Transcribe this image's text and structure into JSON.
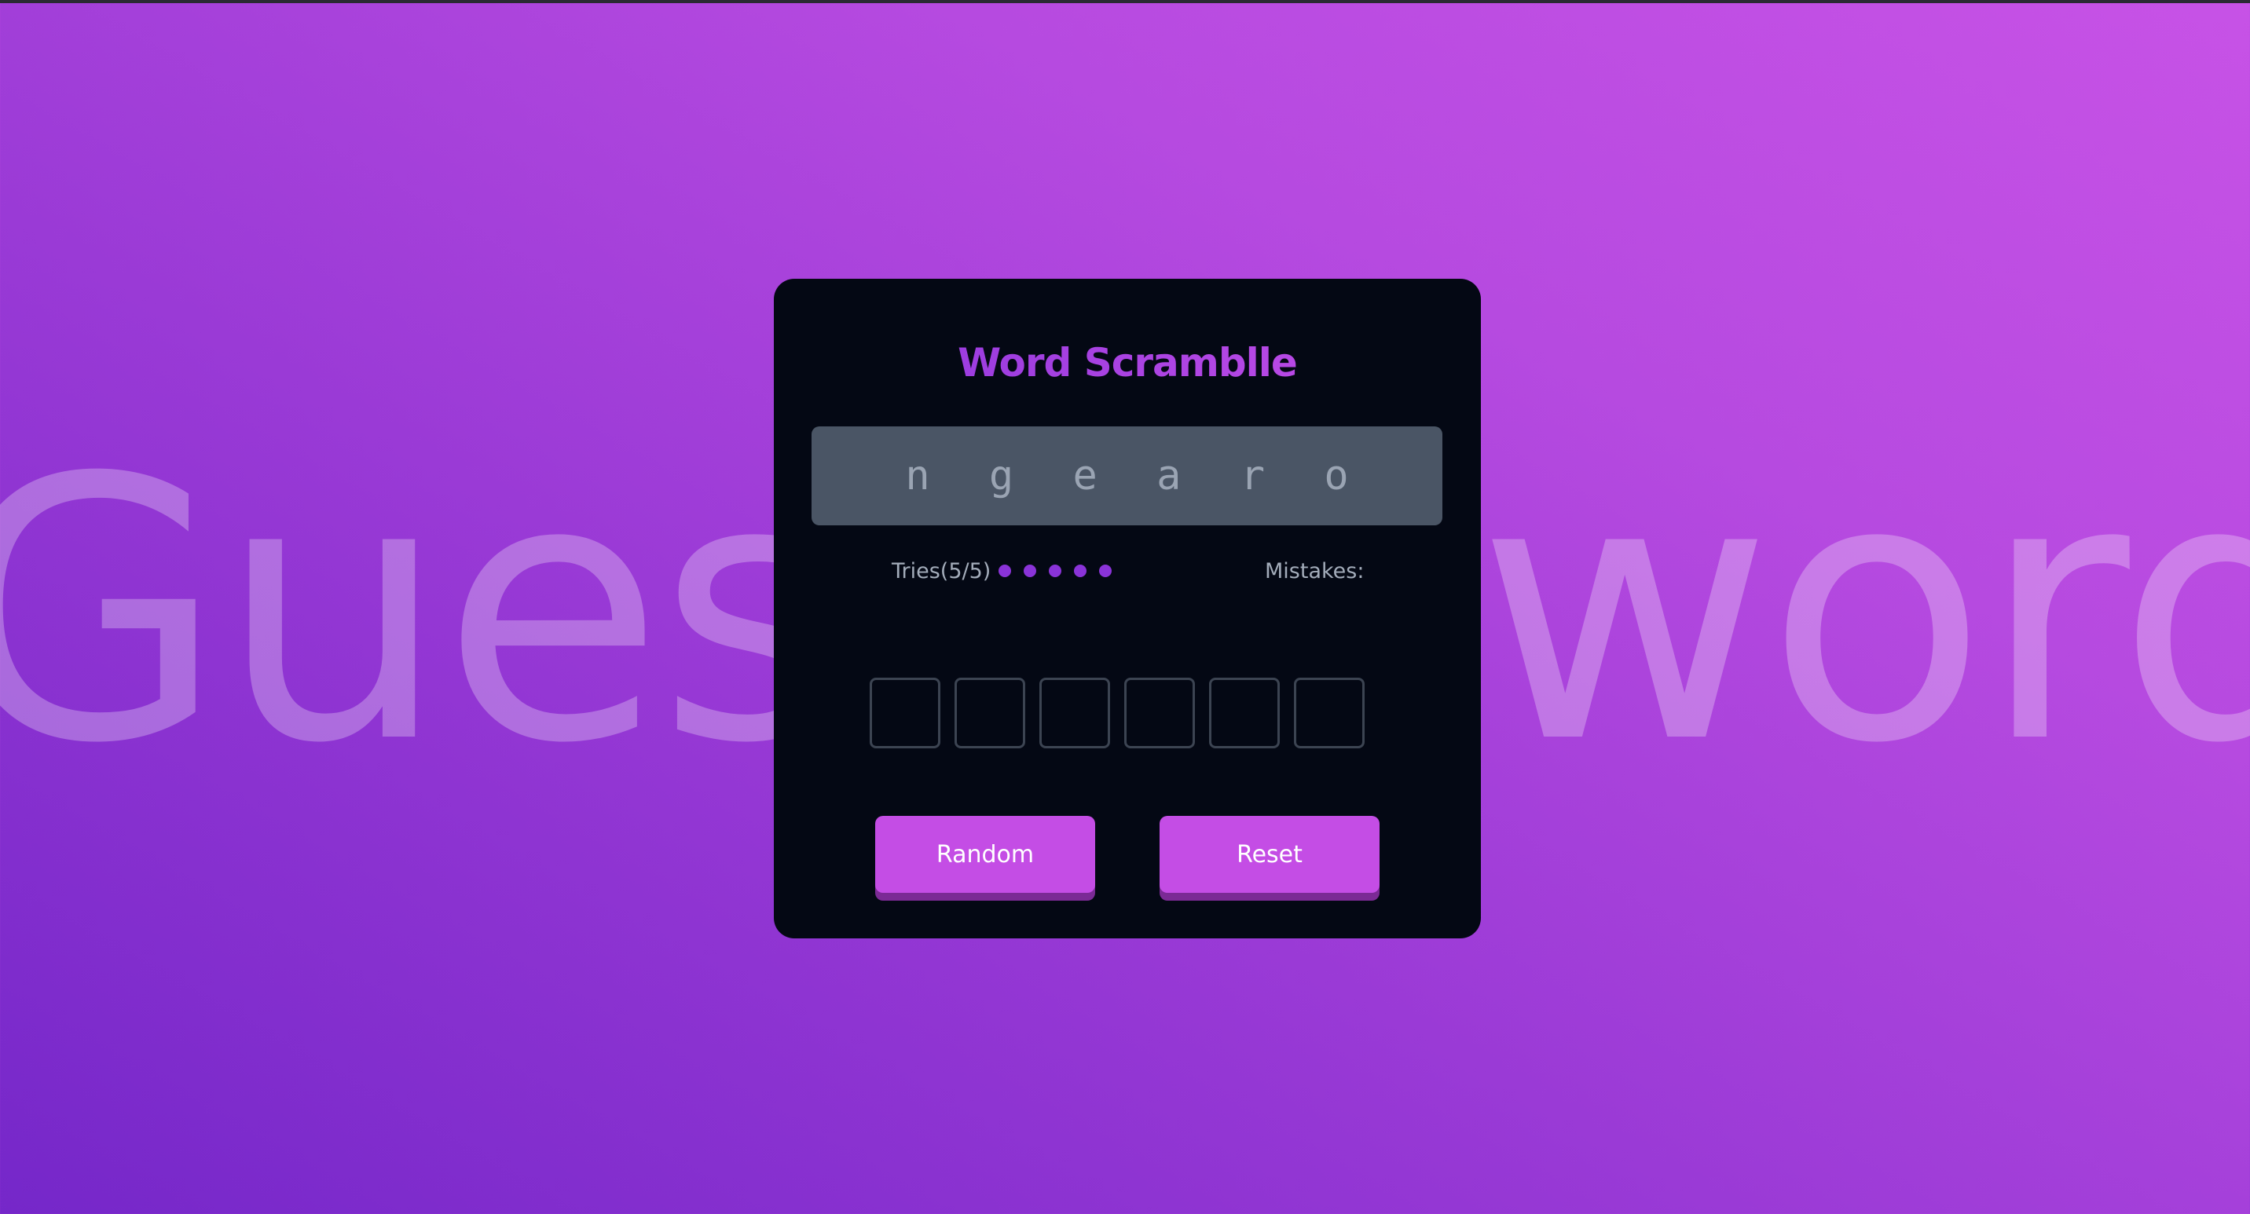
{
  "background": {
    "left_word": "Guess",
    "right_word": "word"
  },
  "game": {
    "title": "Word Scramblle",
    "scrambled_word": "n g e a r o",
    "tries_label": "Tries(5/5)",
    "tries_remaining": 5,
    "tries_total": 5,
    "mistakes_label": "Mistakes:",
    "letter_box_count": 6
  },
  "buttons": {
    "random_label": "Random",
    "reset_label": "Reset"
  },
  "colors": {
    "accent": "#c44de5",
    "dot": "#8a33d8",
    "card": "#040814",
    "scramble_box": "#4a5565"
  }
}
